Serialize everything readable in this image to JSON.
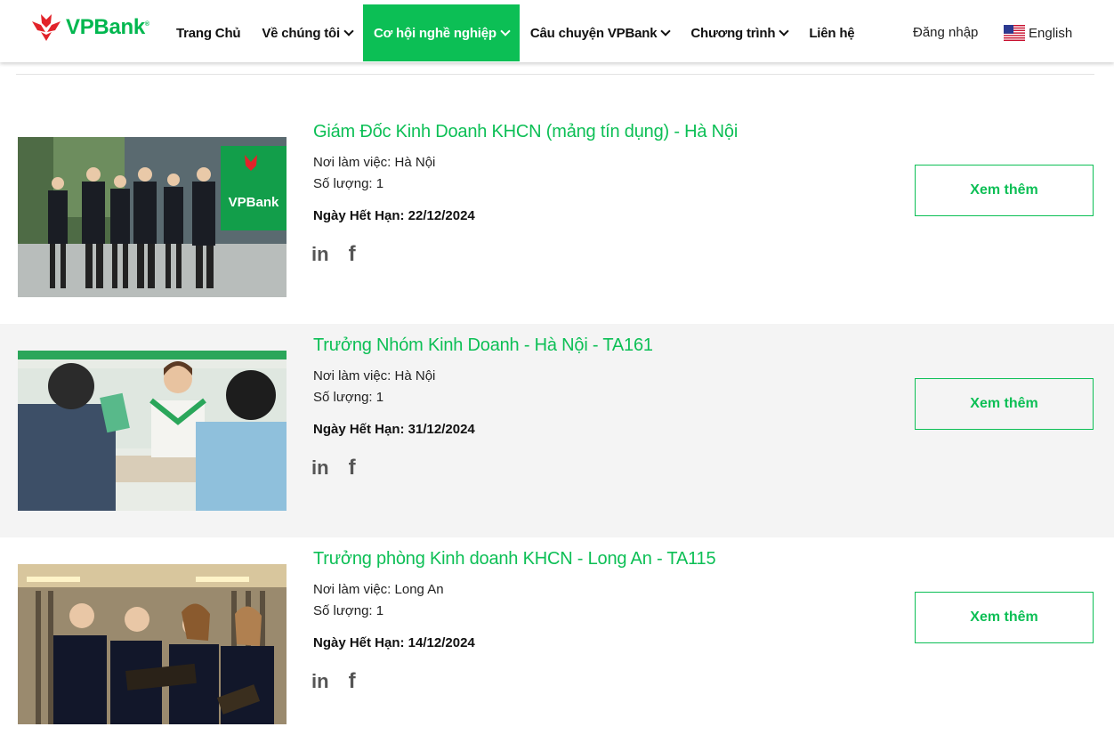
{
  "brand": {
    "name": "VPBank",
    "reg": "®",
    "color": "#00b74f",
    "accent": "#e2232a"
  },
  "nav": {
    "items": [
      {
        "label": "Trang Chủ",
        "has_dropdown": false
      },
      {
        "label": "Về chúng tôi",
        "has_dropdown": true
      },
      {
        "label": "Cơ hội nghề nghiệp",
        "has_dropdown": true,
        "active": true
      },
      {
        "label": "Câu chuyện VPBank",
        "has_dropdown": true
      },
      {
        "label": "Chương trình",
        "has_dropdown": true
      },
      {
        "label": "Liên hệ",
        "has_dropdown": false
      }
    ],
    "login_label": "Đăng nhập",
    "language_label": "English",
    "language_icon": "us-flag-icon"
  },
  "jobs": [
    {
      "title": "Giám Đốc Kinh Doanh KHCN (mảng tín dụng) - Hà Nội",
      "location": "Nơi làm việc: Hà Nội",
      "quantity": "Số lượng: 1",
      "expiry": "Ngày Hết Hạn: 22/12/2024",
      "share_icons": [
        "linkedin-icon",
        "facebook-icon"
      ],
      "button_label": "Xem thêm",
      "image_sign_text": "VPBank"
    },
    {
      "title": "Trưởng Nhóm Kinh Doanh - Hà Nội - TA161",
      "location": "Nơi làm việc: Hà Nội",
      "quantity": "Số lượng: 1",
      "expiry": "Ngày Hết Hạn: 31/12/2024",
      "share_icons": [
        "linkedin-icon",
        "facebook-icon"
      ],
      "button_label": "Xem thêm"
    },
    {
      "title": "Trưởng phòng Kinh doanh KHCN - Long An - TA115",
      "location": "Nơi làm việc: Long An",
      "quantity": "Số lượng: 1",
      "expiry": "Ngày Hết Hạn: 14/12/2024",
      "share_icons": [
        "linkedin-icon",
        "facebook-icon"
      ],
      "button_label": "Xem thêm"
    }
  ],
  "colors": {
    "green": "#0cbf55",
    "alt_row": "#f4f4f4"
  }
}
